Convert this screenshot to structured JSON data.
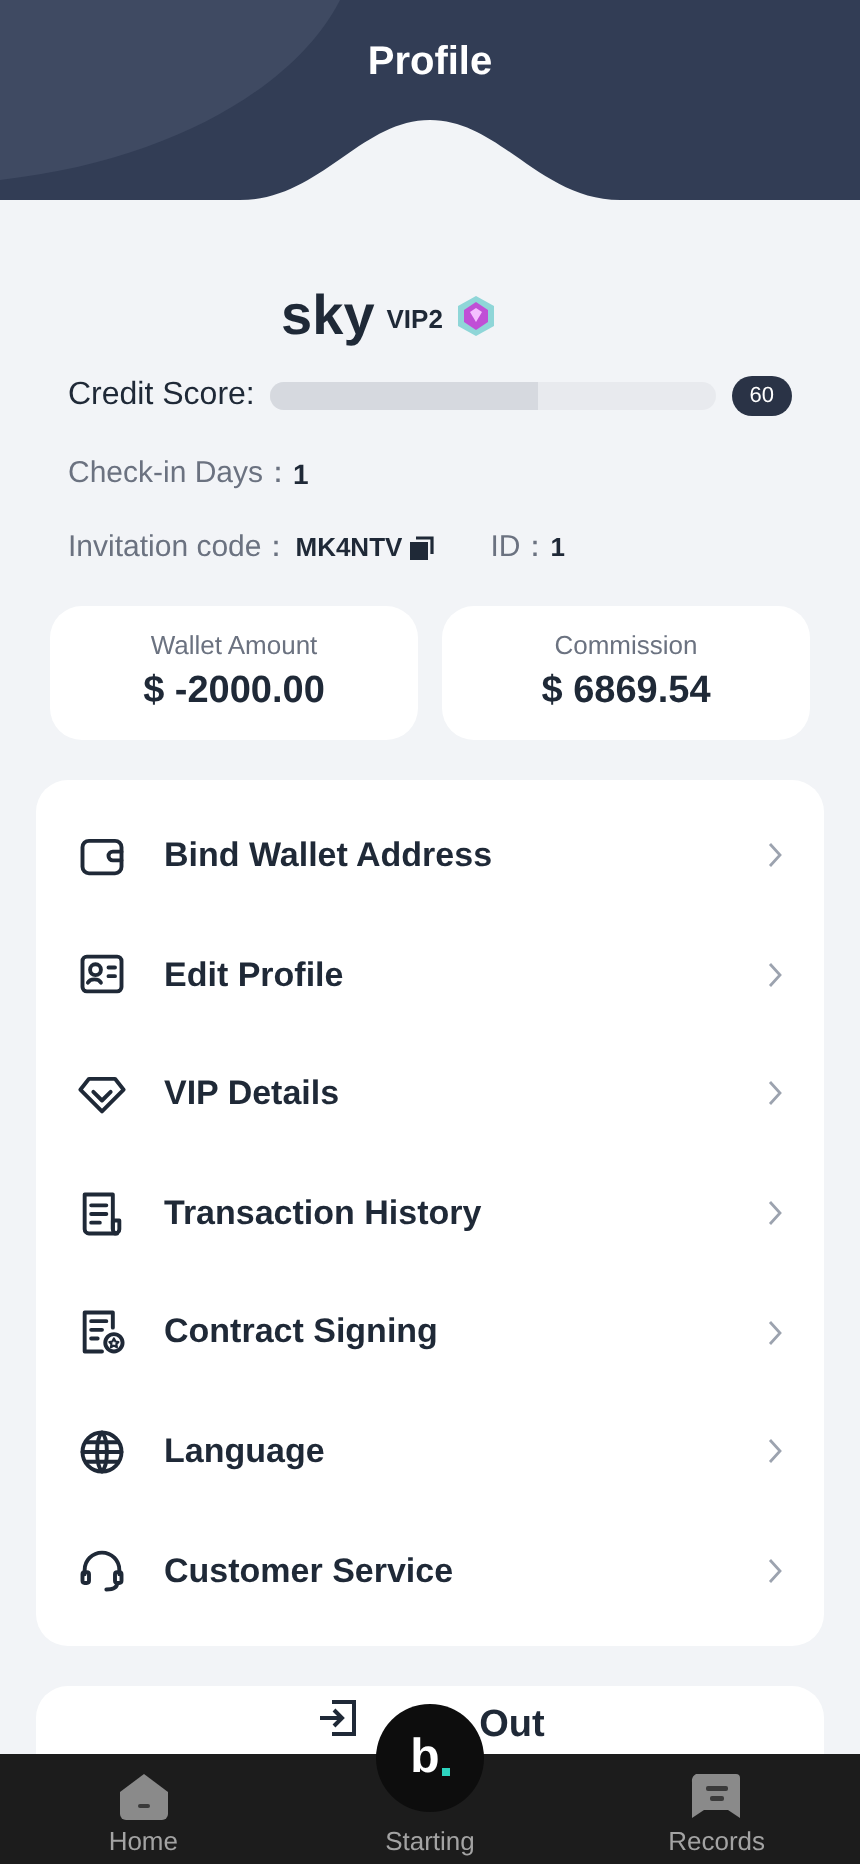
{
  "header": {
    "title": "Profile"
  },
  "user": {
    "name": "sky",
    "vip": "VIP2"
  },
  "credit": {
    "label": "Credit Score:",
    "level": 0.6,
    "score": "60"
  },
  "checkin": {
    "label": "Check-in Days：",
    "value": "1"
  },
  "invitation": {
    "label": "Invitation code：",
    "code": "MK4NTV",
    "id_label": "ID：",
    "id": "1"
  },
  "balances": [
    {
      "label": "Wallet Amount",
      "value": "$ -2000.00"
    },
    {
      "label": "Commission",
      "value": "$ 6869.54"
    }
  ],
  "menu": [
    {
      "kind": "wallet",
      "label": "Bind Wallet Address"
    },
    {
      "kind": "profile",
      "label": "Edit Profile"
    },
    {
      "kind": "vip",
      "label": "VIP Details"
    },
    {
      "kind": "history",
      "label": "Transaction History"
    },
    {
      "kind": "contract",
      "label": "Contract Signing"
    },
    {
      "kind": "language",
      "label": "Language"
    },
    {
      "kind": "service",
      "label": "Customer Service"
    }
  ],
  "logout": {
    "label": "Out"
  },
  "logo": {
    "letter": "b"
  },
  "nav": [
    {
      "kind": "home",
      "label": "Home"
    },
    {
      "kind": "center",
      "label": "Starting"
    },
    {
      "kind": "records",
      "label": "Records"
    }
  ]
}
